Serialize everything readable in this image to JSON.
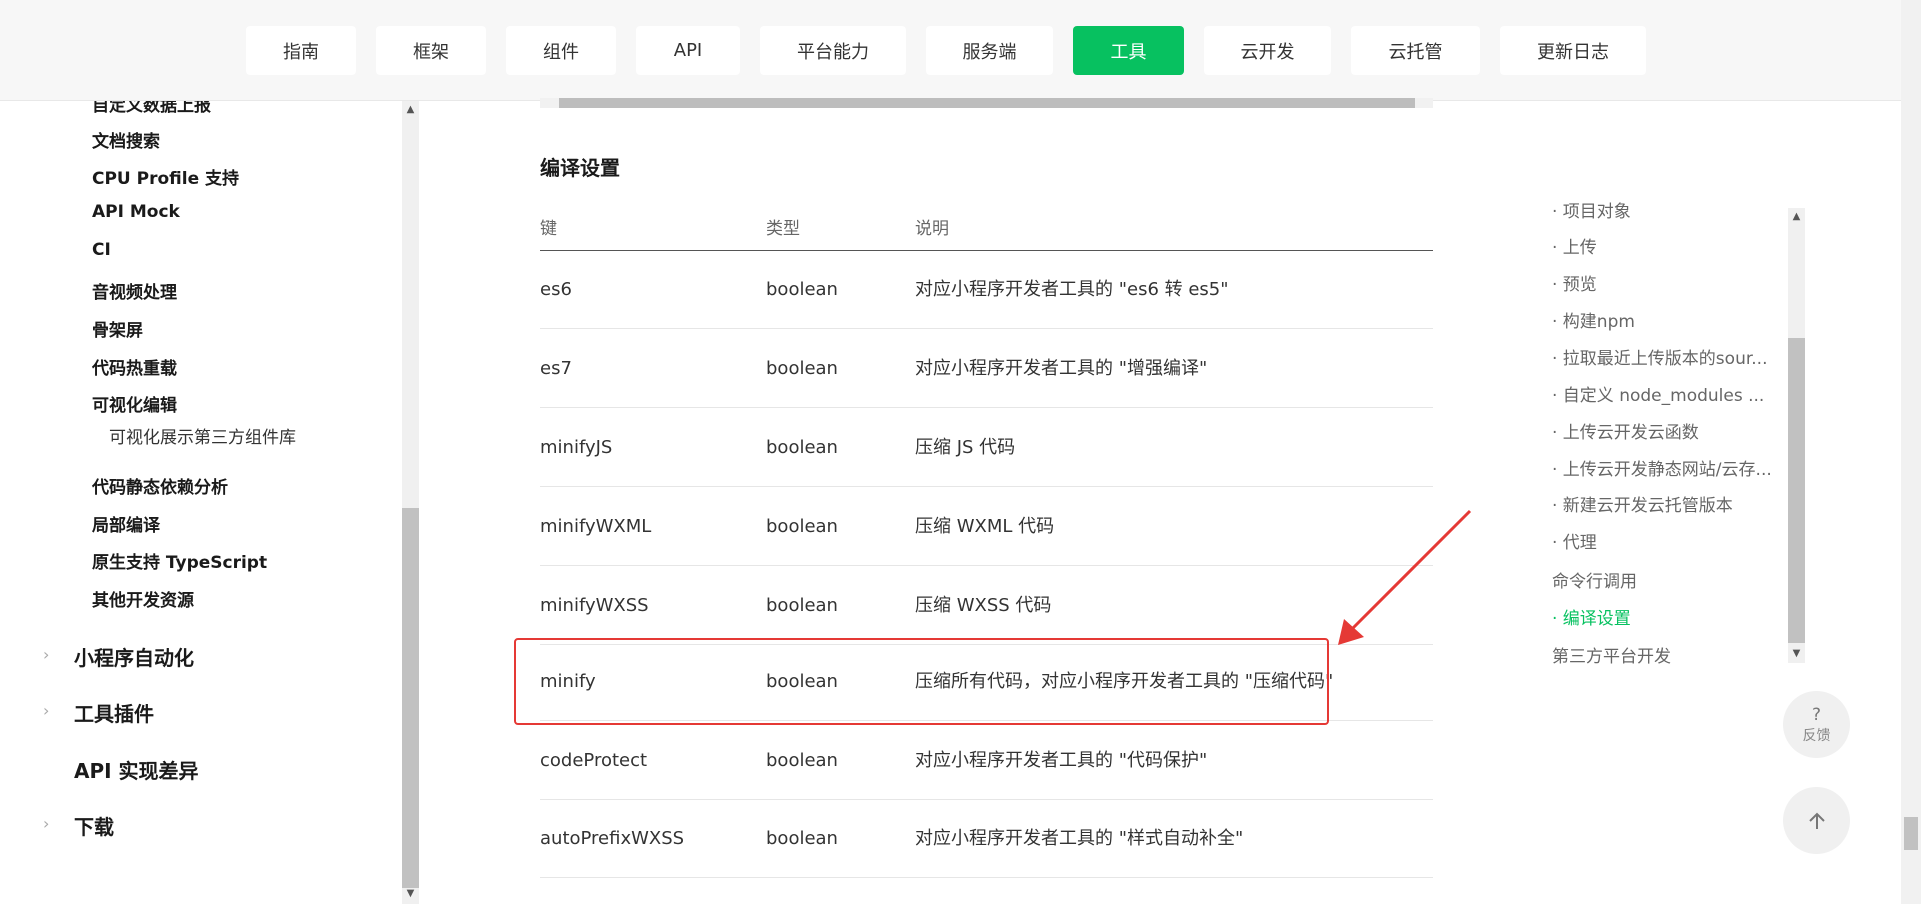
{
  "topnav": {
    "items": [
      {
        "label": "指南"
      },
      {
        "label": "框架"
      },
      {
        "label": "组件"
      },
      {
        "label": "API"
      },
      {
        "label": "平台能力"
      },
      {
        "label": "服务端"
      },
      {
        "label": "工具",
        "active": true
      },
      {
        "label": "云开发"
      },
      {
        "label": "云托管"
      },
      {
        "label": "更新日志"
      }
    ]
  },
  "sidebar": {
    "partial_top": "自定义数据上报",
    "items": [
      {
        "label": "文档搜索"
      },
      {
        "label": "CPU Profile 支持"
      },
      {
        "label": "API Mock"
      },
      {
        "label": "CI"
      },
      {
        "label": "音视频处理"
      },
      {
        "label": "骨架屏"
      },
      {
        "label": "代码热重载"
      },
      {
        "label": "可视化编辑"
      },
      {
        "label": "可视化展示第三方组件库"
      },
      {
        "label": "代码静态依赖分析"
      },
      {
        "label": "局部编译"
      },
      {
        "label": "原生支持 TypeScript"
      },
      {
        "label": "其他开发资源"
      }
    ],
    "sections": [
      {
        "label": "小程序自动化"
      },
      {
        "label": "工具插件"
      },
      {
        "label": "API 实现差异"
      },
      {
        "label": "下载"
      }
    ]
  },
  "main": {
    "section_title": "编译设置",
    "table": {
      "headers": [
        "键",
        "类型",
        "说明"
      ],
      "rows": [
        {
          "key": "es6",
          "type": "boolean",
          "desc": "对应小程序开发者工具的 \"es6 转 es5\""
        },
        {
          "key": "es7",
          "type": "boolean",
          "desc": "对应小程序开发者工具的 \"增强编译\""
        },
        {
          "key": "minifyJS",
          "type": "boolean",
          "desc": "压缩 JS 代码"
        },
        {
          "key": "minifyWXML",
          "type": "boolean",
          "desc": "压缩 WXML 代码"
        },
        {
          "key": "minifyWXSS",
          "type": "boolean",
          "desc": "压缩 WXSS 代码"
        },
        {
          "key": "minify",
          "type": "boolean",
          "desc": "压缩所有代码，对应小程序开发者工具的 \"压缩代码\""
        },
        {
          "key": "codeProtect",
          "type": "boolean",
          "desc": "对应小程序开发者工具的 \"代码保护\""
        },
        {
          "key": "autoPrefixWXSS",
          "type": "boolean",
          "desc": "对应小程序开发者工具的 \"样式自动补全\""
        }
      ]
    }
  },
  "toc": {
    "partial_top": "· 项目对象",
    "items": [
      {
        "label": "· 上传"
      },
      {
        "label": "· 预览"
      },
      {
        "label": "· 构建npm"
      },
      {
        "label": "· 拉取最近上传版本的sour..."
      },
      {
        "label": "· 自定义 node_modules ..."
      },
      {
        "label": "· 上传云开发云函数"
      },
      {
        "label": "· 上传云开发静态网站/云存..."
      },
      {
        "label": "· 新建云开发云托管版本"
      },
      {
        "label": "· 代理"
      },
      {
        "label": "命令行调用"
      },
      {
        "label": "· 编译设置",
        "active": true
      },
      {
        "label": "第三方平台开发"
      }
    ]
  },
  "feedback": {
    "icon": "?",
    "label": "反馈"
  },
  "colors": {
    "accent": "#07c160",
    "highlight": "#e53935",
    "annotation_arrow": "#e53935"
  }
}
